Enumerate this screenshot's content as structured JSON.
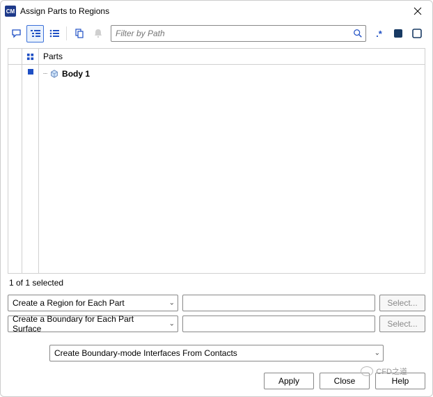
{
  "window": {
    "app_icon_text": "CM",
    "title": "Assign Parts to Regions"
  },
  "toolbar": {
    "filter_placeholder": "Filter by Path",
    "regex_label": ".*"
  },
  "tree": {
    "header_label": "Parts",
    "items": [
      {
        "label": "Body 1",
        "selected": true
      }
    ]
  },
  "status_text": "1 of 1 selected",
  "region_combo": {
    "value": "Create a Region for Each Part",
    "input_value": "",
    "select_label": "Select..."
  },
  "boundary_combo": {
    "value": "Create a Boundary for Each Part Surface",
    "input_value": "",
    "select_label": "Select..."
  },
  "interface_combo": {
    "value": "Create Boundary-mode Interfaces From Contacts"
  },
  "footer": {
    "apply": "Apply",
    "close": "Close",
    "help": "Help"
  },
  "watermark": "CFD之道",
  "colors": {
    "accent": "#1e4fc4"
  }
}
